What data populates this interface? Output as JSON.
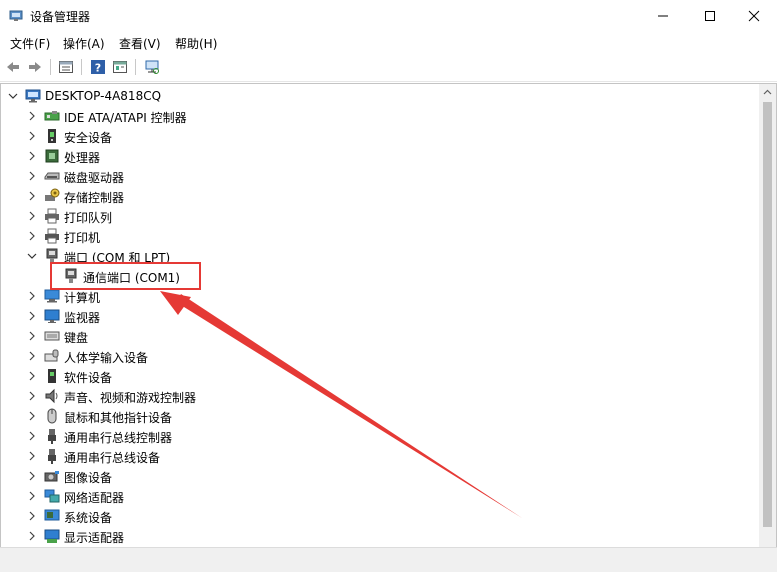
{
  "window": {
    "title": "设备管理器"
  },
  "menu": [
    "文件(F)",
    "操作(A)",
    "查看(V)",
    "帮助(H)"
  ],
  "toolbar": {
    "buttons": [
      "back-icon",
      "forward-icon",
      "properties-icon",
      "help-icon",
      "show-hidden-icon",
      "scan-hardware-icon"
    ]
  },
  "tree": {
    "root": "DESKTOP-4A818CQ",
    "items": [
      {
        "label": "IDE ATA/ATAPI 控制器",
        "icon": "ide-controller-icon",
        "expanded": false
      },
      {
        "label": "安全设备",
        "icon": "security-device-icon",
        "expanded": false
      },
      {
        "label": "处理器",
        "icon": "processor-icon",
        "expanded": false
      },
      {
        "label": "磁盘驱动器",
        "icon": "disk-drive-icon",
        "expanded": false
      },
      {
        "label": "存储控制器",
        "icon": "storage-controller-icon",
        "expanded": false
      },
      {
        "label": "打印队列",
        "icon": "print-queue-icon",
        "expanded": false
      },
      {
        "label": "打印机",
        "icon": "printer-icon",
        "expanded": false
      },
      {
        "label": "端口 (COM 和 LPT)",
        "icon": "port-icon",
        "expanded": true
      },
      {
        "label": "通信端口 (COM1)",
        "icon": "port-icon",
        "child": true
      },
      {
        "label": "计算机",
        "icon": "computer-icon",
        "expanded": false
      },
      {
        "label": "监视器",
        "icon": "monitor-icon",
        "expanded": false
      },
      {
        "label": "键盘",
        "icon": "keyboard-icon",
        "expanded": false
      },
      {
        "label": "人体学输入设备",
        "icon": "hid-icon",
        "expanded": false
      },
      {
        "label": "软件设备",
        "icon": "software-device-icon",
        "expanded": false
      },
      {
        "label": "声音、视频和游戏控制器",
        "icon": "sound-icon",
        "expanded": false
      },
      {
        "label": "鼠标和其他指针设备",
        "icon": "mouse-icon",
        "expanded": false
      },
      {
        "label": "通用串行总线控制器",
        "icon": "usb-icon",
        "expanded": false
      },
      {
        "label": "通用串行总线设备",
        "icon": "usb-icon",
        "expanded": false
      },
      {
        "label": "图像设备",
        "icon": "camera-icon",
        "expanded": false
      },
      {
        "label": "网络适配器",
        "icon": "network-icon",
        "expanded": false
      },
      {
        "label": "系统设备",
        "icon": "system-device-icon",
        "expanded": false
      },
      {
        "label": "显示适配器",
        "icon": "display-adapter-icon",
        "expanded": false
      }
    ]
  },
  "annotation": {
    "color": "#e53935"
  }
}
